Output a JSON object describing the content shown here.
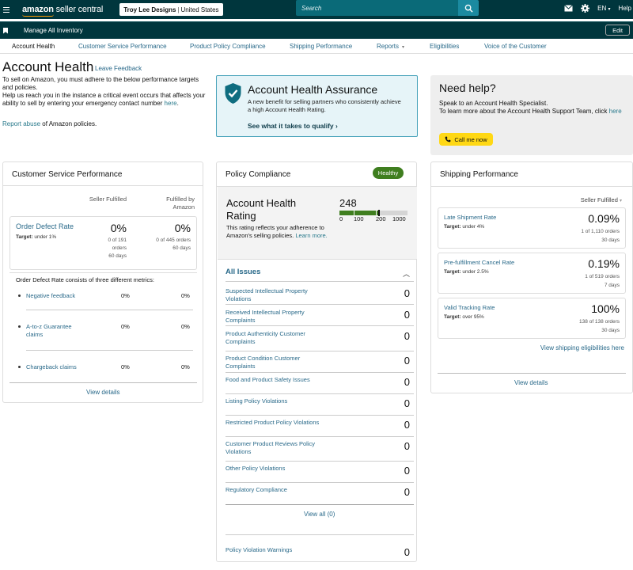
{
  "topbar": {
    "logo_bold": "amazon",
    "logo_rest": " seller central",
    "account_name": "Troy Lee Designs",
    "account_region": "United States",
    "search_placeholder": "Search",
    "language": "EN",
    "help": "Help"
  },
  "subbar": {
    "manage": "Manage All Inventory",
    "edit": "Edit"
  },
  "tabs": [
    "Account Health",
    "Customer Service Performance",
    "Product Policy Compliance",
    "Shipping Performance",
    "Reports",
    "Eligibilities",
    "Voice of the Customer"
  ],
  "header": {
    "title": "Account Health",
    "leave_feedback": "Leave Feedback",
    "intro_1": "To sell on Amazon, you must adhere to the below performance targets and policies.",
    "intro_2": "Help us reach you in the instance a critical event occurs that affects your ability to sell by entering your emergency contact number ",
    "intro_link": "here",
    "intro_end": ".",
    "report_link": "Report abuse",
    "report_rest": " of Amazon policies."
  },
  "aha": {
    "title": "Account Health Assurance",
    "desc": "A new benefit for selling partners who consistently achieve a high Account Health Rating.",
    "cta": "See what it takes to qualify"
  },
  "help": {
    "title": "Need help?",
    "line1": "Speak to an Account Health Specialist.",
    "line2": "To learn more about the Account Health Support Team, click ",
    "link": "here",
    "call": "Call me now"
  },
  "csp": {
    "title": "Customer Service Performance",
    "col1": "Seller Fulfilled",
    "col2_a": "Fulfilled by",
    "col2_b": "Amazon",
    "odr_name": "Order Defect Rate",
    "odr_target_label": "Target:",
    "odr_target": "under 1%",
    "odr_sf_pct": "0%",
    "odr_sf_orders_a": "0 of 191",
    "odr_sf_orders_b": "orders",
    "odr_sf_days": "60 days",
    "odr_fba_pct": "0%",
    "odr_fba_orders": "0 of 445 orders",
    "odr_fba_days": "60 days",
    "consists": "Order Defect Rate consists of three different metrics:",
    "metrics": [
      {
        "label": "Negative feedback",
        "sf": "0%",
        "fba": "0%"
      },
      {
        "label": "A-to-z Guarantee claims",
        "sf": "0%",
        "fba": "0%"
      },
      {
        "label": "Chargeback claims",
        "sf": "0%",
        "fba": "0%"
      }
    ],
    "view_details": "View details"
  },
  "policy": {
    "title": "Policy Compliance",
    "badge": "Healthy",
    "ahr_title": "Account Health Rating",
    "ahr_desc": "This rating reflects your adherence to Amazon's selling policies. ",
    "ahr_learn": "Learn more.",
    "score": "248",
    "score_value": 248,
    "ticks": [
      "0",
      "100",
      "200",
      "1000"
    ],
    "all_issues": "All Issues",
    "issues": [
      {
        "label": "Suspected Intellectual Property Violations",
        "count": "0"
      },
      {
        "label": "Received Intellectual Property Complaints",
        "count": "0"
      },
      {
        "label": "Product Authenticity Customer Complaints",
        "count": "0"
      },
      {
        "label": "Product Condition Customer Complaints",
        "count": "0"
      },
      {
        "label": "Food and Product Safety Issues",
        "count": "0"
      },
      {
        "label": "Listing Policy Violations",
        "count": "0"
      },
      {
        "label": "Restricted Product Policy Violations",
        "count": "0"
      },
      {
        "label": "Customer Product Reviews Policy Violations",
        "count": "0"
      },
      {
        "label": "Other Policy Violations",
        "count": "0"
      },
      {
        "label": "Regulatory Compliance",
        "count": "0"
      }
    ],
    "view_all": "View all (0)",
    "warnings_label": "Policy Violation Warnings",
    "warnings_count": "0"
  },
  "shipping": {
    "title": "Shipping Performance",
    "dropdown": "Seller Fulfilled",
    "metrics": [
      {
        "name": "Late Shipment Rate",
        "target_label": "Target:",
        "target": "under 4%",
        "pct": "0.09%",
        "orders": "1 of 1,110 orders",
        "days": "30 days"
      },
      {
        "name": "Pre-fulfillment Cancel Rate",
        "target_label": "Target:",
        "target": "under 2.5%",
        "pct": "0.19%",
        "orders": "1 of 519 orders",
        "days": "7 days"
      },
      {
        "name": "Valid Tracking Rate",
        "target_label": "Target:",
        "target": "over 95%",
        "pct": "100%",
        "orders": "138 of 138 orders",
        "days": "30 days"
      }
    ],
    "eligibility_link": "View shipping eligibilities here",
    "view_details": "View details"
  },
  "colors": {
    "topbar_bg": "#00363d",
    "link": "#2a6a8a",
    "healthy_green": "#3f7e1f",
    "call_yellow": "#ffd814",
    "aha_bg": "#e6f4f8"
  }
}
